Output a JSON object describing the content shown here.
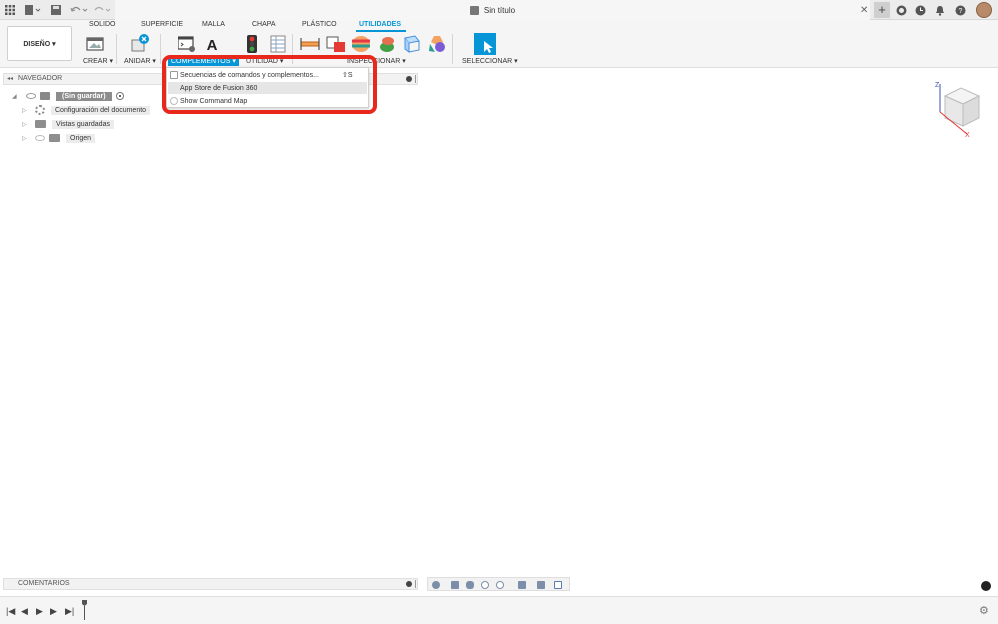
{
  "titlebar": {
    "doc_title": "Sin título",
    "icons": [
      "grid-icon",
      "file-icon",
      "save-icon",
      "undo-icon",
      "redo-icon",
      "close-icon",
      "plus-icon",
      "clock-icon",
      "bell-icon",
      "help-icon",
      "avatar"
    ]
  },
  "ribbon": {
    "workspace_label": "DISEÑO ▾",
    "tabs": [
      {
        "label": "SOLIDO"
      },
      {
        "label": "SUPERFICIE"
      },
      {
        "label": "MALLA"
      },
      {
        "label": "CHAPA"
      },
      {
        "label": "PLÁSTICO"
      },
      {
        "label": "UTILIDADES",
        "active": true
      }
    ],
    "groups": {
      "crear": "CREAR ▾",
      "anidar": "ANIDAR ▾",
      "complementos": "COMPLEMENTOS ▾",
      "utilidad": "UTILIDAD ▾",
      "inspeccionar": "INSPECCIONAR ▾",
      "seleccionar": "SELECCIONAR ▾"
    },
    "accent_color": "#0696d7"
  },
  "menu": {
    "items": [
      {
        "label": "Secuencias de comandos y complementos...",
        "shortcut": "⇧S"
      },
      {
        "label": "App Store de Fusion 360",
        "highlighted": true
      },
      {
        "label": "Show Command Map"
      }
    ],
    "highlight_color": "#e8271d"
  },
  "navigator": {
    "title": "NAVEGADOR",
    "root": "(Sin guardar)",
    "items": [
      {
        "label": "Configuración del documento"
      },
      {
        "label": "Vistas guardadas"
      },
      {
        "label": "Origen"
      }
    ]
  },
  "viewcube": {
    "z": "Z",
    "x": "X"
  },
  "comments": {
    "title": "COMENTARIOS"
  }
}
